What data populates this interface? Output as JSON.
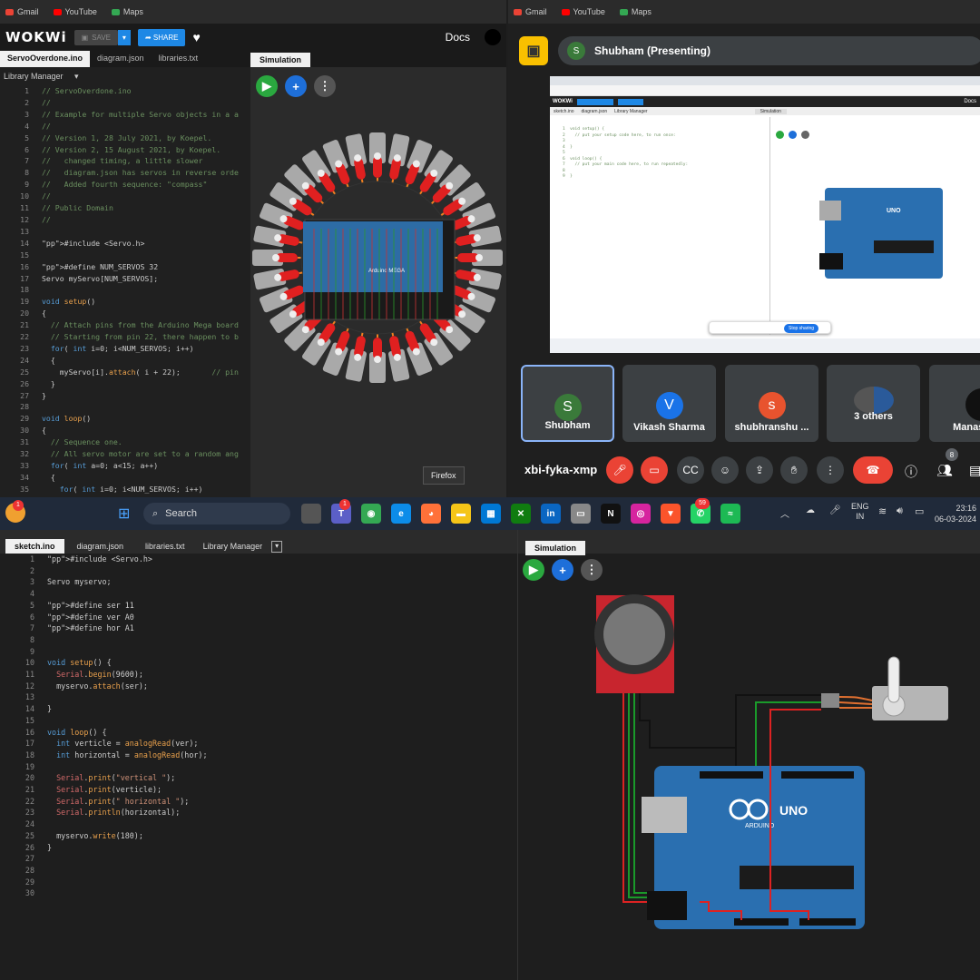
{
  "bookmarks": [
    "Gmail",
    "YouTube",
    "Maps"
  ],
  "wokwi_top": {
    "logo": "WOKWi",
    "save_label": "SAVE",
    "share_label": "SHARE",
    "docs_label": "Docs",
    "tabs": [
      "ServoOverdone.ino",
      "diagram.json",
      "libraries.txt"
    ],
    "library_manager": "Library Manager",
    "simulation_tab": "Simulation",
    "firefox_tooltip": "Firefox",
    "board_label": "Arduino MEGA",
    "code": [
      "// ServoOverdone.ino",
      "//",
      "// Example for multiple Servo objects in a a",
      "//",
      "// Version 1, 28 July 2021, by Koepel.",
      "// Version 2, 15 August 2021, by Koepel.",
      "//   changed timing, a little slower",
      "//   diagram.json has servos in reverse orde",
      "//   Added fourth sequence: \"compass\"",
      "//",
      "// Public Domain",
      "//",
      "",
      "#include <Servo.h>",
      "",
      "#define NUM_SERVOS 32",
      "Servo myServo[NUM_SERVOS];",
      "",
      "void setup()",
      "{",
      "  // Attach pins from the Arduino Mega board",
      "  // Starting from pin 22, there happen to b",
      "  for( int i=0; i<NUM_SERVOS; i++)",
      "  {",
      "    myServo[i].attach( i + 22);       // pin",
      "  }",
      "}",
      "",
      "void loop()",
      "{",
      "  // Sequence one.",
      "  // All servo motor are set to a random ang",
      "  for( int a=0; a<15; a++)",
      "  {",
      "    for( int i=0; i<NUM_SERVOS; i++)"
    ]
  },
  "meet": {
    "presenter": "Shubham (Presenting)",
    "presenter_initial": "S",
    "meeting_code": "xbi-fyka-xmp",
    "participants_count": "8",
    "participants": [
      {
        "name": "Shubham",
        "initial": "S",
        "color": "#3a7a3a"
      },
      {
        "name": "Vikash Sharma",
        "initial": "V",
        "color": "#1a73e8"
      },
      {
        "name": "shubhranshu ...",
        "initial": "s",
        "color": "#e8532e"
      },
      {
        "name": "3 others",
        "initial": "",
        "color": "#555"
      },
      {
        "name": "Manas Sa",
        "initial": "",
        "color": "#111"
      }
    ],
    "shared": {
      "tabs": [
        "sketch.ino",
        "diagram.json",
        "Library Manager"
      ],
      "simulation": "Simulation",
      "code": [
        "void setup() {",
        "  // put your setup code here, to run once:",
        "",
        "}",
        "",
        "void loop() {",
        "  // put your main code here, to run repeatedly:",
        "",
        "}"
      ],
      "stop_sharing": "Stop sharing",
      "uno": "UNO",
      "docs": "Docs"
    }
  },
  "taskbar": {
    "search_placeholder": "Search",
    "lang1": "ENG",
    "lang2": "IN",
    "time": "23:16",
    "date": "06-03-2024",
    "badges": {
      "teams": "1",
      "whatsapp": "59",
      "weather": "1"
    }
  },
  "wokwi_bottom": {
    "tabs": [
      "sketch.ino",
      "diagram.json",
      "libraries.txt",
      "Library Manager"
    ],
    "simulation_tab": "Simulation",
    "board_uno": "UNO",
    "board_brand": "ARDUINO",
    "code": [
      "#include <Servo.h>",
      "",
      "Servo myservo;",
      "",
      "#define ser 11",
      "#define ver A0",
      "#define hor A1",
      "",
      "",
      "void setup() {",
      "  Serial.begin(9600);",
      "  myservo.attach(ser);",
      "",
      "}",
      "",
      "void loop() {",
      "  int verticle = analogRead(ver);",
      "  int horizontal = analogRead(hor);",
      "",
      "  Serial.print(\"vertical \");",
      "  Serial.print(verticle);",
      "  Serial.print(\" horizontal \");",
      "  Serial.println(horizontal);",
      "",
      "  myservo.write(180);",
      "}",
      "",
      "",
      "",
      ""
    ]
  }
}
